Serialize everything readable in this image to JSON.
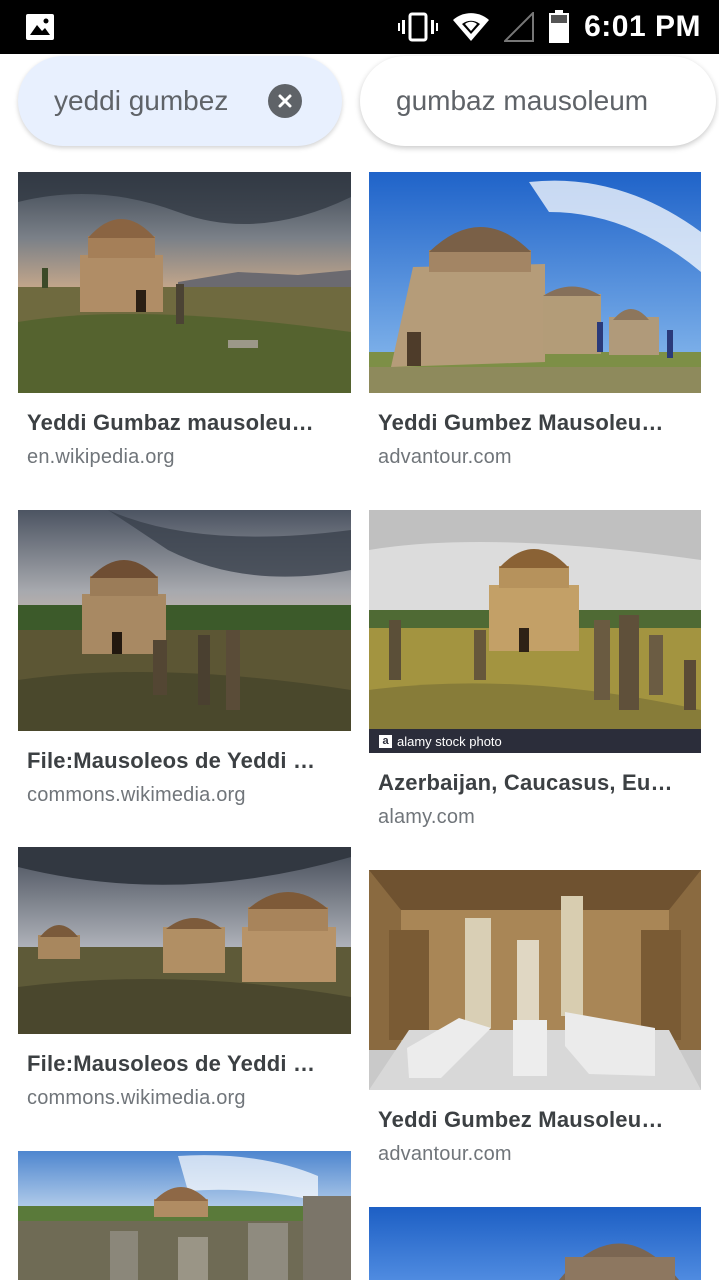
{
  "status_bar": {
    "time": "6:01 PM"
  },
  "chips": {
    "active": {
      "label": "yeddi gumbez"
    },
    "suggestion": {
      "label": "gumbaz mausoleum"
    }
  },
  "results": [
    {
      "title": "Yeddi Gumbaz mausoleu…",
      "source": "en.wikipedia.org"
    },
    {
      "title": "Yeddi Gumbez Mausoleu…",
      "source": "advantour.com"
    },
    {
      "title": "File:Mausoleos de Yeddi …",
      "source": "commons.wikimedia.org"
    },
    {
      "title": "Azerbaijan, Caucasus, Eu…",
      "source": "alamy.com",
      "watermark": "alamy stock photo",
      "watermark_logo": "a"
    },
    {
      "title": "File:Mausoleos de Yeddi …",
      "source": "commons.wikimedia.org"
    },
    {
      "title": "Yeddi Gumbez Mausoleu…",
      "source": "advantour.com"
    }
  ]
}
